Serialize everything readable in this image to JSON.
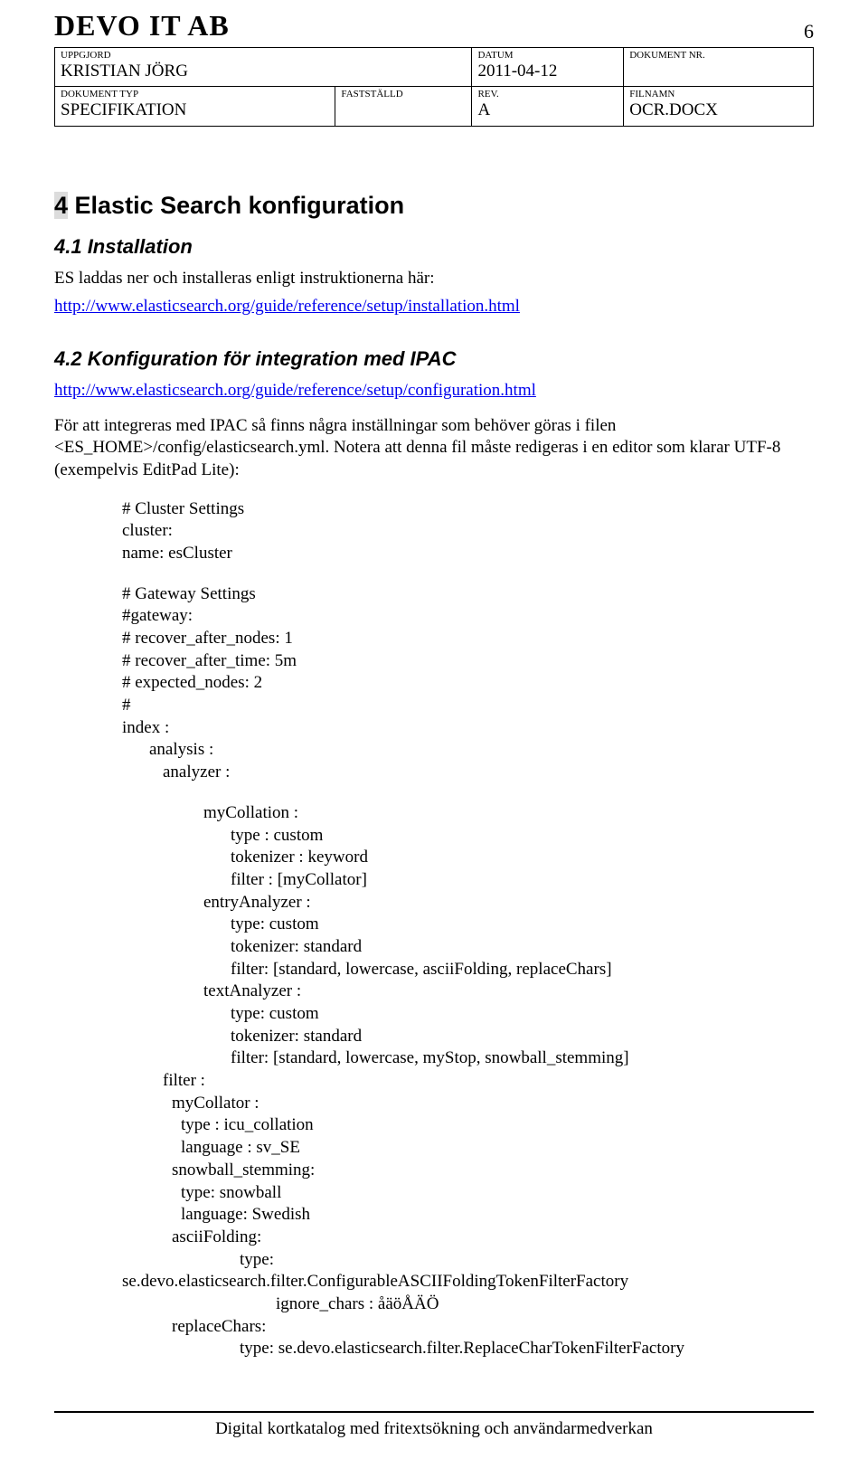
{
  "header": {
    "company": "DEVO IT AB",
    "page_number": "6",
    "meta": {
      "row1": {
        "uppgjord_label": "UPPGJORD",
        "uppgjord_value": "KRISTIAN JÖRG",
        "datum_label": "DATUM",
        "datum_value": "2011-04-12",
        "dokumentnr_label": "DOKUMENT NR.",
        "dokumentnr_value": ""
      },
      "row2": {
        "dokumenttyp_label": "DOKUMENT TYP",
        "dokumenttyp_value": "SPECIFIKATION",
        "faststalld_label": "FASTSTÄLLD",
        "faststalld_value": "",
        "rev_label": "REV.",
        "rev_value": "A",
        "filnamn_label": "FILNAMN",
        "filnamn_value": "OCR.DOCX"
      }
    }
  },
  "section4": {
    "number": "4",
    "title_rest": " Elastic Search konfiguration"
  },
  "section41": {
    "title": "4.1 Installation",
    "text": "ES laddas ner och  installeras enligt instruktionerna här:",
    "link": "http://www.elasticsearch.org/guide/reference/setup/installation.html"
  },
  "section42": {
    "title": "4.2 Konfiguration för integration med IPAC",
    "link": "http://www.elasticsearch.org/guide/reference/setup/configuration.html",
    "para": "För att integreras med IPAC så finns några inställningar som behöver göras i filen <ES_HOME>/config/elasticsearch.yml. Notera att denna fil måste redigeras i en editor som klarar UTF-8 (exempelvis EditPad Lite):"
  },
  "config": {
    "l1": "# Cluster Settings",
    "l2": "cluster:",
    "l3": "  name: esCluster",
    "l4": "# Gateway Settings",
    "l5": "#gateway:",
    "l6": "#  recover_after_nodes: 1",
    "l7": "#  recover_after_time: 5m",
    "l8": "#  expected_nodes: 2",
    "l9": "#",
    "l10": "index :",
    "l11": "analysis :",
    "l12": "analyzer :",
    "l13": "myCollation :",
    "l14": "type : custom",
    "l15": "tokenizer : keyword",
    "l16": "filter : [myCollator]",
    "l17": "entryAnalyzer :",
    "l18": "type: custom",
    "l19": "tokenizer: standard",
    "l20": "filter: [standard, lowercase, asciiFolding, replaceChars]",
    "l21": "textAnalyzer :",
    "l22": "type: custom",
    "l23": "tokenizer: standard",
    "l24": "filter: [standard, lowercase, myStop, snowball_stemming]",
    "l25": "filter :",
    "l26": "myCollator :",
    "l27": "type : icu_collation",
    "l28": "language : sv_SE",
    "l29": "snowball_stemming:",
    "l30": "type: snowball",
    "l31": "language: Swedish",
    "l32": "asciiFolding:",
    "l33": "type:",
    "l34": "se.devo.elasticsearch.filter.ConfigurableASCIIFoldingTokenFilterFactory",
    "l35": "ignore_chars : åäöÅÄÖ",
    "l36": "replaceChars:",
    "l37": "type: se.devo.elasticsearch.filter.ReplaceCharTokenFilterFactory"
  },
  "footer": {
    "text": "Digital kortkatalog med fritextsökning och användarmedverkan"
  }
}
